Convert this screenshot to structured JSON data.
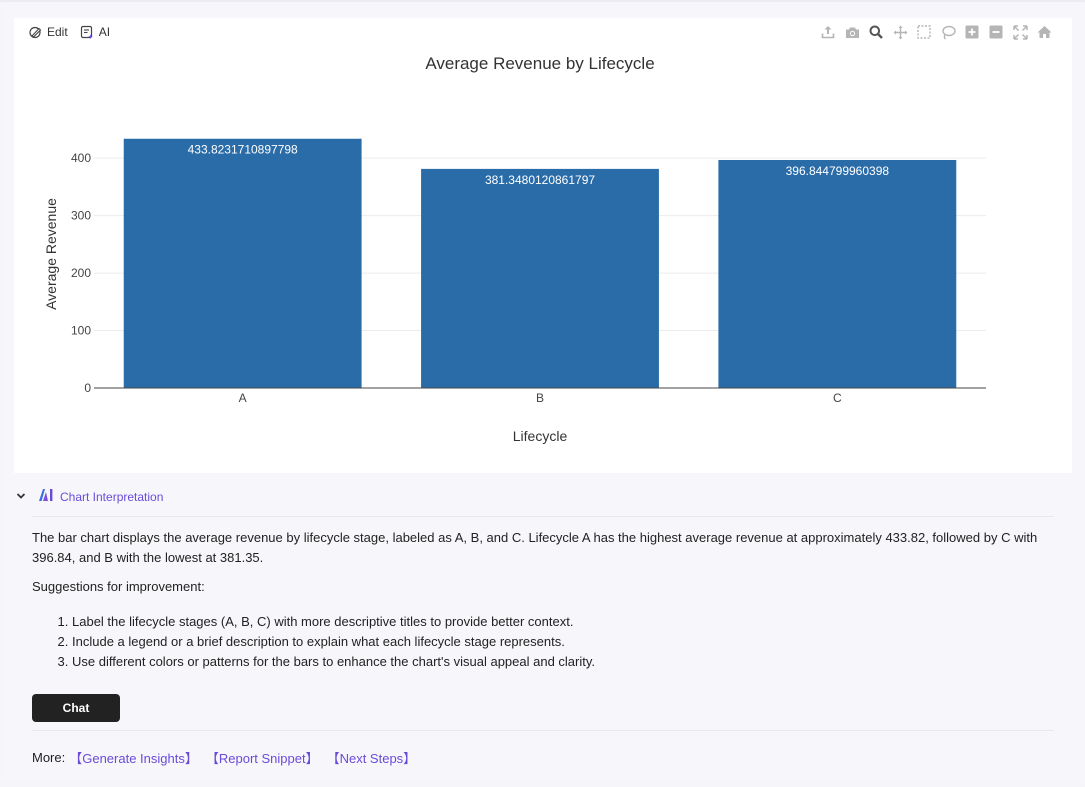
{
  "toolbar": {
    "edit_label": "Edit",
    "ai_label": "AI",
    "modebar_icons": [
      "export-icon",
      "camera-icon",
      "zoom-icon",
      "pan-icon",
      "box-select-icon",
      "lasso-select-icon",
      "zoom-in-icon",
      "zoom-out-icon",
      "autoscale-icon",
      "reset-axes-icon"
    ]
  },
  "chart_data": {
    "type": "bar",
    "title": "Average Revenue by Lifecycle",
    "xlabel": "Lifecycle",
    "ylabel": "Average Revenue",
    "categories": [
      "A",
      "B",
      "C"
    ],
    "values": [
      433.8231710897798,
      381.3480120861797,
      396.844799960398
    ],
    "data_labels": [
      "433.8231710897798",
      "381.3480120861797",
      "396.844799960398"
    ],
    "yticks": [
      "0",
      "100",
      "200",
      "300",
      "400"
    ],
    "ylim": [
      0,
      456
    ],
    "grid": true,
    "bar_color": "#2a6ca8"
  },
  "interpretation": {
    "header": "Chart Interpretation",
    "summary": "The bar chart displays the average revenue by lifecycle stage, labeled as A, B, and C. Lifecycle A has the highest average revenue at approximately 433.82, followed by C with 396.84, and B with the lowest at 381.35.",
    "suggestions_title": "Suggestions for improvement:",
    "suggestions": [
      "Label the lifecycle stages (A, B, C) with more descriptive titles to provide better context.",
      "Include a legend or a brief description to explain what each lifecycle stage represents.",
      "Use different colors or patterns for the bars to enhance the chart's visual appeal and clarity."
    ]
  },
  "chat_label": "Chat",
  "more": {
    "label": "More:",
    "links": [
      "【Generate Insights】",
      "【Report Snippet】",
      "【Next Steps】"
    ]
  },
  "colors": {
    "accent": "#6a4bd8",
    "bar": "#2a6ca8"
  }
}
